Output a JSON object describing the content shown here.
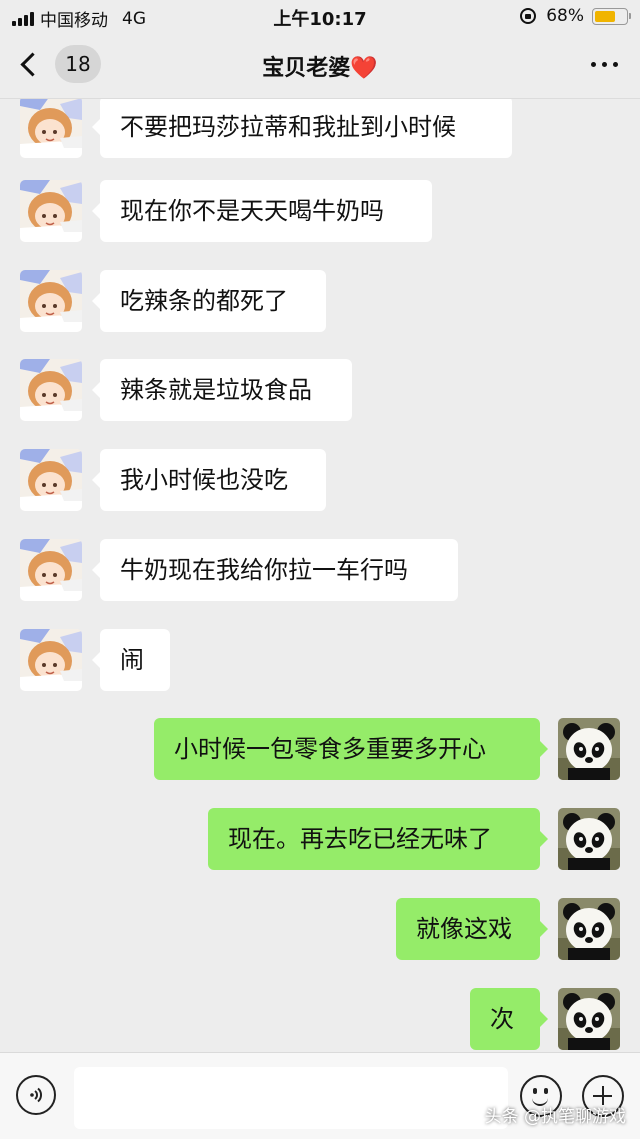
{
  "status_bar": {
    "carrier": "中国移动",
    "network": "4G",
    "time": "上午10:17",
    "battery_percent": "68%",
    "battery_level": 0.68
  },
  "nav": {
    "back_count": "18",
    "title": "宝贝老婆",
    "title_emoji": "❤️"
  },
  "messages": [
    {
      "side": "left",
      "text": "不要把玛莎拉蒂和我扯到小时候",
      "avatar": "cartoon-girl-avatar"
    },
    {
      "side": "left",
      "text": "现在你不是天天喝牛奶吗",
      "avatar": "cartoon-girl-avatar"
    },
    {
      "side": "left",
      "text": "吃辣条的都死了",
      "avatar": "cartoon-girl-avatar"
    },
    {
      "side": "left",
      "text": "辣条就是垃圾食品",
      "avatar": "cartoon-girl-avatar"
    },
    {
      "side": "left",
      "text": "我小时候也没吃",
      "avatar": "cartoon-girl-avatar"
    },
    {
      "side": "left",
      "text": "牛奶现在我给你拉一车行吗",
      "avatar": "cartoon-girl-avatar"
    },
    {
      "side": "left",
      "text": "闹",
      "avatar": "cartoon-girl-avatar"
    },
    {
      "side": "right",
      "text": "小时候一包零食多重要多开心",
      "avatar": "panda-avatar"
    },
    {
      "side": "right",
      "text": "现在。再去吃已经无味了",
      "avatar": "panda-avatar"
    },
    {
      "side": "right",
      "text": "就像这戏",
      "avatar": "panda-avatar"
    },
    {
      "side": "right",
      "text": "次",
      "avatar": "panda-avatar"
    }
  ],
  "input": {
    "value": "",
    "placeholder": ""
  },
  "icons": {
    "voice": "voice-icon",
    "emoji": "emoji-icon",
    "plus": "plus-icon",
    "more": "more-icon",
    "back": "chevron-left-icon"
  },
  "colors": {
    "background": "#ededed",
    "bubble_left": "#ffffff",
    "bubble_right": "#95ec69",
    "battery": "#f0b400"
  },
  "watermark": "头条 @执笔聊游戏"
}
